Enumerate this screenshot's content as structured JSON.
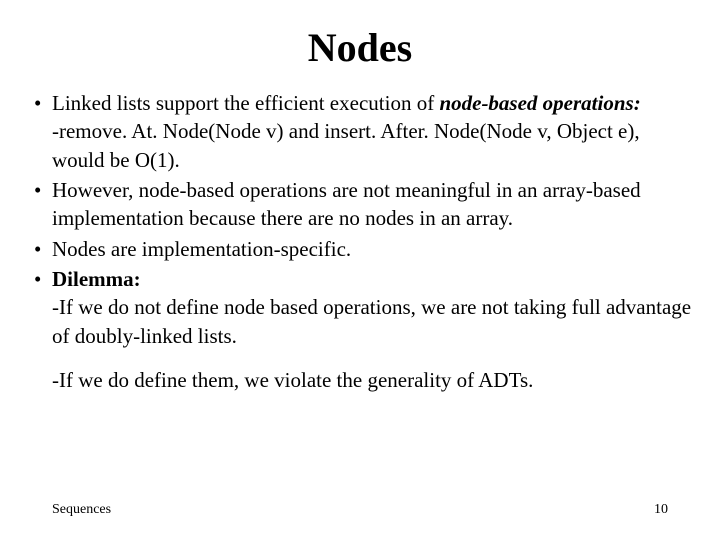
{
  "title": "Nodes",
  "bullets": {
    "b1": {
      "text_pre": "Linked lists support the efficient execution of ",
      "emph": "node-based operations:",
      "line2_a": "-remove. At. Node(Node v) and insert. After. Node(Node v, Object e),",
      "line3": "would be O(1)."
    },
    "b2": "However, node-based operations are not meaningful in an array-based implementation because there are no nodes in an array.",
    "b3": "Nodes are implementation-specific.",
    "b4": {
      "head": "Dilemma:",
      "line": "-If we do not define node based operations, we are not taking full advantage of doubly-linked lists."
    }
  },
  "extra": "-If we do define them, we violate the generality of ADTs.",
  "footer": {
    "left": "Sequences",
    "right": "10"
  }
}
